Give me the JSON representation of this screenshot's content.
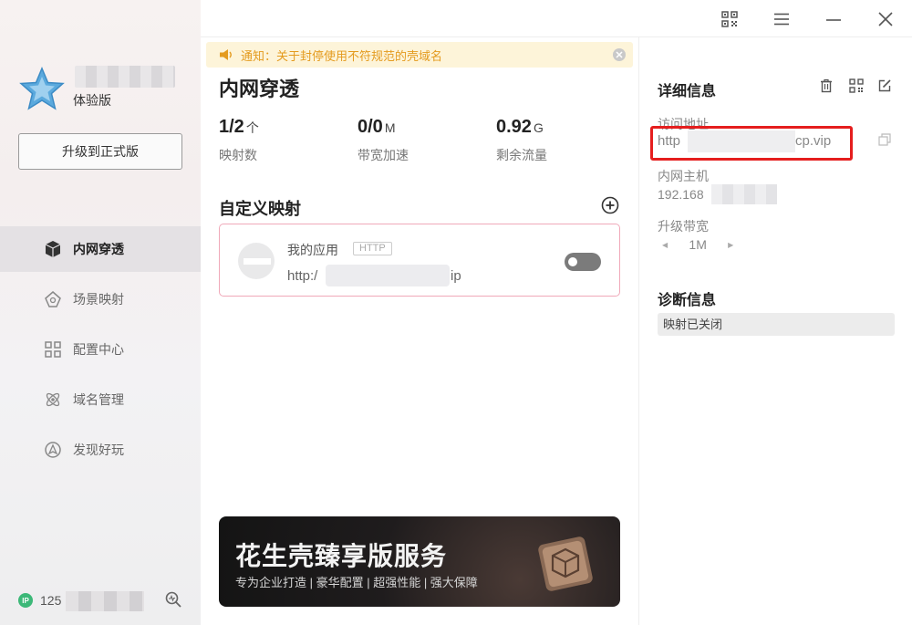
{
  "sidebar": {
    "user_tier": "体验版",
    "upgrade_label": "升级到正式版",
    "nav": [
      {
        "label": "内网穿透",
        "icon": "cube-icon",
        "active": true
      },
      {
        "label": "场景映射",
        "icon": "scene-icon",
        "active": false
      },
      {
        "label": "配置中心",
        "icon": "grid-icon",
        "active": false
      },
      {
        "label": "域名管理",
        "icon": "atom-icon",
        "active": false
      },
      {
        "label": "发现好玩",
        "icon": "compass-icon",
        "active": false
      }
    ],
    "ip_badge": "IP",
    "ip_prefix": "125"
  },
  "topbar": {
    "icons": [
      "qr-code-icon",
      "menu-icon",
      "minimize-icon",
      "close-icon"
    ]
  },
  "notice": {
    "text": "通知：关于封停使用不符规范的壳域名"
  },
  "main": {
    "title": "内网穿透",
    "stats": [
      {
        "value": "1/2",
        "unit": "个",
        "label": "映射数"
      },
      {
        "value": "0/0",
        "unit": "M",
        "label": "带宽加速"
      },
      {
        "value": "0.92",
        "unit": "G",
        "label": "剩余流量"
      }
    ],
    "section_title": "自定义映射",
    "mapping": {
      "name": "我的应用",
      "protocol": "HTTP",
      "url_prefix": "http:/",
      "url_suffix": "ip",
      "enabled": false
    }
  },
  "promo": {
    "title": "花生壳臻享版服务",
    "subtitle": "专为企业打造 | 豪华配置 | 超强性能 | 强大保障"
  },
  "details": {
    "title": "详细信息",
    "access_label": "访问地址",
    "access_prefix": "http",
    "access_suffix": "cp.vip",
    "host_label": "内网主机",
    "host_prefix": "192.168",
    "bandwidth_label": "升级带宽",
    "bandwidth_value": "1M",
    "diag_title": "诊断信息",
    "diag_status": "映射已关闭"
  },
  "colors": {
    "accent_red": "#e51e1e",
    "notice_text": "#e49b1f",
    "ip_green": "#3cb878",
    "card_border": "#f0a9b9"
  }
}
